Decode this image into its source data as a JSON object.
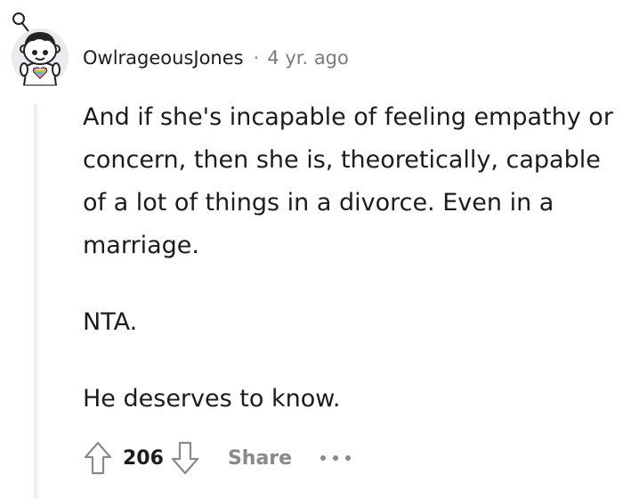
{
  "comment": {
    "author": "OwlrageousJones",
    "separator": "·",
    "timestamp": "4 yr. ago",
    "avatar_icon": "snoo-avatar-icon",
    "paragraphs": [
      "And if she's incapable of feeling empathy or concern, then she is, theoretically, capable of a lot of things in a divorce. Even in a marriage.",
      "NTA.",
      "He deserves to know."
    ]
  },
  "actions": {
    "upvote_icon": "upvote-arrow-icon",
    "score": "206",
    "downvote_icon": "downvote-arrow-icon",
    "share_label": "Share",
    "more_icon": "more-options-icon"
  },
  "colors": {
    "text": "#1c1c1c",
    "meta": "#878a8c",
    "thread_line": "#edeff1"
  }
}
